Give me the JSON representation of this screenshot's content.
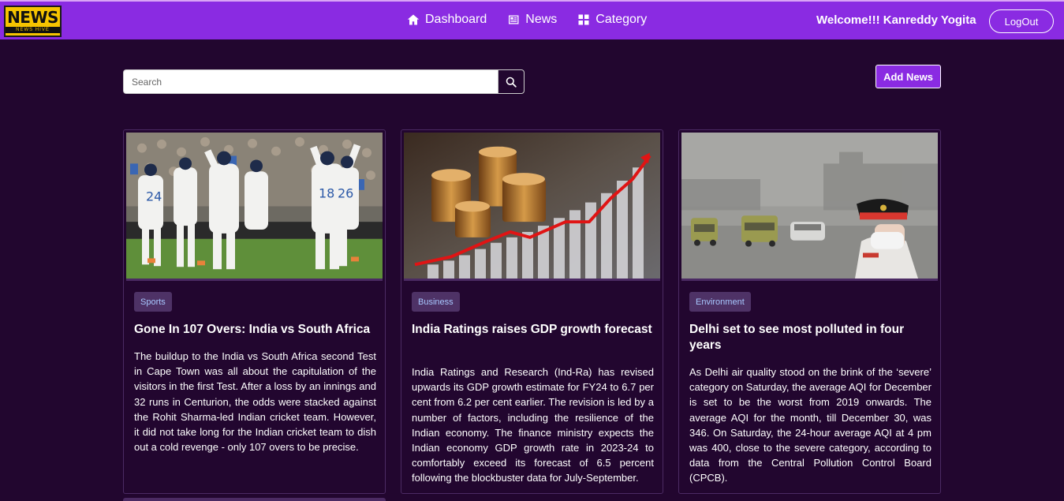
{
  "navbar": {
    "logo_main": "NEWS",
    "logo_sub": "NEWS HIVE",
    "links": [
      "Dashboard",
      "News",
      "Category"
    ],
    "welcome": "Welcome!!! Kanreddy Yogita",
    "logout": "LogOut"
  },
  "search": {
    "placeholder": "Search"
  },
  "add_news": "Add News",
  "cards": [
    {
      "category": "Sports",
      "title": "Gone In 107 Overs: India vs South Africa",
      "body": "The buildup to the India vs South Africa second Test in Cape Town was all about the capitulation of the visitors in the first Test. After a loss by an innings and 32 runs in Centurion, the odds were stacked against the Rohit Sharma-led Indian cricket team. However, it did not take long for the Indian cricket team to dish out a cold revenge - only 107 overs to be precise."
    },
    {
      "category": "Business",
      "title": "India Ratings raises GDP growth forecast",
      "body": "India Ratings and Research (Ind-Ra) has revised upwards its GDP growth estimate for FY24 to 6.7 per cent from 6.2 per cent earlier. The revision is led by a number of factors, including the resilience of the Indian economy. The finance ministry expects the Indian economy GDP growth rate in 2023-24 to comfortably exceed its forecast of 6.5 percent following the blockbuster data for July-September."
    },
    {
      "category": "Environment",
      "title": "Delhi set to see most polluted in four years",
      "body": "As Delhi air quality stood on the brink of the ‘severe’ category on Saturday, the average AQI for December is set to be the worst from 2019 onwards. The average AQI for the month, till December 30, was 346. On Saturday, the 24-hour average AQI at 4 pm was 400, close to the severe category, according to data from the Central Pollution Control Board (CPCB)."
    }
  ],
  "colors": {
    "navbar": "#8a2be2",
    "background": "#22062f",
    "badge": "#4e3266",
    "badge_text": "#a8c8ff"
  }
}
